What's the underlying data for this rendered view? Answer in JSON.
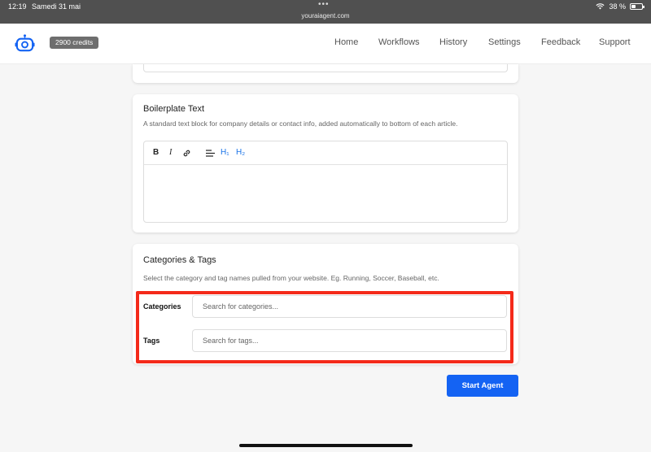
{
  "statusbar": {
    "time": "12:19",
    "date": "Samedi 31 mai",
    "dots": "•••",
    "url": "youraiagent.com",
    "battery": "38 %"
  },
  "navbar": {
    "credits": "2900 credits",
    "items": [
      "Home",
      "Workflows",
      "History",
      "Settings",
      "Feedback",
      "Support"
    ]
  },
  "boilerplate": {
    "title": "Boilerplate Text",
    "description": "A standard text block for company details or contact info, added automatically to bottom of each article.",
    "toolbar": {
      "bold": "B",
      "italic": "I",
      "h1": "H₁",
      "h2": "H₂"
    }
  },
  "categories_tags": {
    "title": "Categories & Tags",
    "description": "Select the category and tag names pulled from your website. Eg. Running, Soccer, Baseball, etc.",
    "categories_label": "Categories",
    "categories_placeholder": "Search for categories...",
    "tags_label": "Tags",
    "tags_placeholder": "Search for tags..."
  },
  "start_button": "Start Agent",
  "colors": {
    "accent": "#1463f3",
    "highlight": "#f42a1a",
    "heading_blue": "#1a73e8"
  }
}
